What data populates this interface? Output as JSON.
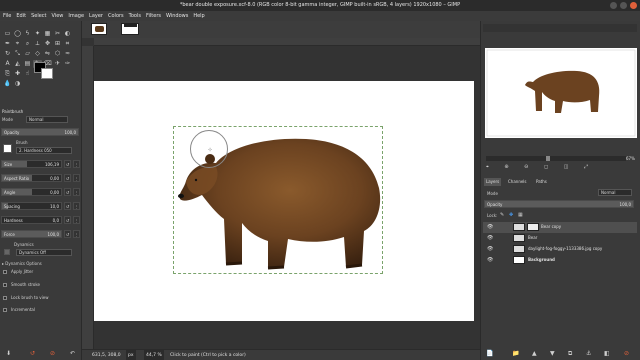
{
  "window": {
    "title": "*bear double exposure.xcf-8.0 (RGB color 8-bit gamma integer, GIMP built-in sRGB, 4 layers) 1920x1080 – GIMP"
  },
  "menu": [
    "File",
    "Edit",
    "Select",
    "View",
    "Image",
    "Layer",
    "Colors",
    "Tools",
    "Filters",
    "Windows",
    "Help"
  ],
  "tool_options": {
    "title": "Paintbrush",
    "mode_label": "Mode",
    "mode_value": "Normal",
    "opacity_label": "Opacity",
    "opacity_value": "100,0",
    "opacity_fraction": 1.0,
    "brush_label": "Brush",
    "brush_value": "2. Hardness 050",
    "sliders": [
      {
        "label": "Size",
        "value": "106,19",
        "fraction": 0.42
      },
      {
        "label": "Aspect Ratio",
        "value": "0,00",
        "fraction": 0.5
      },
      {
        "label": "Angle",
        "value": "0,00",
        "fraction": 0.5
      },
      {
        "label": "Spacing",
        "value": "10,0",
        "fraction": 0.1
      },
      {
        "label": "Hardness",
        "value": "0,0",
        "fraction": 0.0
      },
      {
        "label": "Force",
        "value": "100,0",
        "fraction": 1.0
      }
    ],
    "dynamics_label": "Dynamics",
    "dynamics_value": "Dynamics Off",
    "dynamics_options_label": "Dynamics Options",
    "checkboxes": [
      "Apply Jitter",
      "Smooth stroke",
      "Lock brush to view",
      "Incremental"
    ]
  },
  "status": {
    "coords": "631,5, 308,0",
    "unit": "px",
    "zoom": "44,7 %",
    "message": "Click to paint (Ctrl to pick a color)"
  },
  "navigation": {
    "zoom_value": "67%"
  },
  "layers_panel": {
    "tabs": [
      "Layers",
      "Channels",
      "Paths"
    ],
    "mode_label": "Mode",
    "mode_value": "Normal",
    "opacity_label": "Opacity",
    "opacity_value": "100,0",
    "lock_label": "Lock:",
    "layers": [
      {
        "name": "Bear copy",
        "bold": false
      },
      {
        "name": "Bear",
        "bold": false
      },
      {
        "name": "daylight-fog-foggy-1133386.jpg copy",
        "bold": false
      },
      {
        "name": "Background",
        "bold": true
      }
    ]
  }
}
